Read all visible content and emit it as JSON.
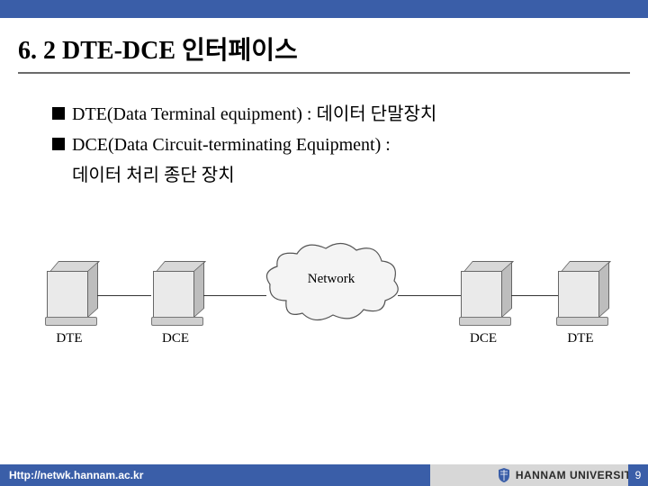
{
  "title": "6. 2 DTE-DCE 인터페이스",
  "bullets": [
    "DTE(Data Terminal equipment) : 데이터 단말장치",
    "DCE(Data Circuit-terminating Equipment) :",
    "데이터 처리 종단 장치"
  ],
  "diagram": {
    "labels": {
      "dte_left": "DTE",
      "dce_left": "DCE",
      "network": "Network",
      "dce_right": "DCE",
      "dte_right": "DTE"
    }
  },
  "footer": {
    "url": "Http://netwk.hannam.ac.kr",
    "org": "HANNAM UNIVERSITY",
    "page": "9"
  }
}
